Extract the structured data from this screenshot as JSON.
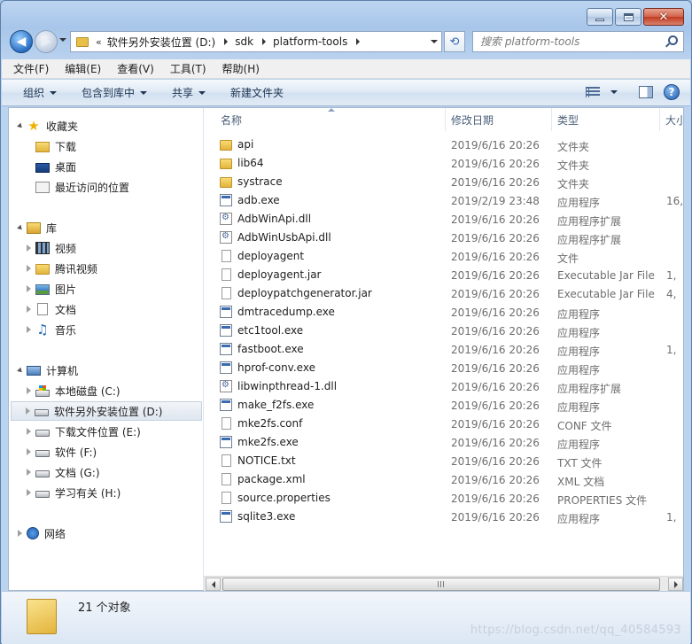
{
  "window": {
    "close_glyph": "✕"
  },
  "nav": {
    "address_chevron": "«",
    "breadcrumbs": [
      "软件另外安装位置 (D:)",
      "sdk",
      "platform-tools"
    ],
    "refresh_glyph": "⟲"
  },
  "search": {
    "placeholder": "搜索 platform-tools"
  },
  "menubar": [
    "文件(F)",
    "编辑(E)",
    "查看(V)",
    "工具(T)",
    "帮助(H)"
  ],
  "toolbar": {
    "organize": "组织",
    "include_library": "包含到库中",
    "share": "共享",
    "new_folder": "新建文件夹",
    "help_glyph": "?"
  },
  "sidebar": {
    "favorites": {
      "label": "收藏夹",
      "items": [
        "下载",
        "桌面",
        "最近访问的位置"
      ]
    },
    "libraries": {
      "label": "库",
      "items": [
        "视频",
        "腾讯视频",
        "图片",
        "文档",
        "音乐"
      ]
    },
    "computer": {
      "label": "计算机",
      "items": [
        "本地磁盘 (C:)",
        "软件另外安装位置 (D:)",
        "下载文件位置 (E:)",
        "软件 (F:)",
        "文档 (G:)",
        "学习有关 (H:)"
      ],
      "selected_index": 1
    },
    "network": {
      "label": "网络"
    }
  },
  "columns": {
    "name": "名称",
    "date": "修改日期",
    "type": "类型",
    "size": "大小"
  },
  "files": [
    {
      "name": "api",
      "date": "2019/6/16 20:26",
      "type": "文件夹",
      "size": "",
      "icon": "folder"
    },
    {
      "name": "lib64",
      "date": "2019/6/16 20:26",
      "type": "文件夹",
      "size": "",
      "icon": "folder"
    },
    {
      "name": "systrace",
      "date": "2019/6/16 20:26",
      "type": "文件夹",
      "size": "",
      "icon": "folder"
    },
    {
      "name": "adb.exe",
      "date": "2019/2/19 23:48",
      "type": "应用程序",
      "size": "16,",
      "icon": "exe"
    },
    {
      "name": "AdbWinApi.dll",
      "date": "2019/6/16 20:26",
      "type": "应用程序扩展",
      "size": "",
      "icon": "dll"
    },
    {
      "name": "AdbWinUsbApi.dll",
      "date": "2019/6/16 20:26",
      "type": "应用程序扩展",
      "size": "",
      "icon": "dll"
    },
    {
      "name": "deployagent",
      "date": "2019/6/16 20:26",
      "type": "文件",
      "size": "",
      "icon": "file"
    },
    {
      "name": "deployagent.jar",
      "date": "2019/6/16 20:26",
      "type": "Executable Jar File",
      "size": "1,",
      "icon": "file"
    },
    {
      "name": "deploypatchgenerator.jar",
      "date": "2019/6/16 20:26",
      "type": "Executable Jar File",
      "size": "4,",
      "icon": "file"
    },
    {
      "name": "dmtracedump.exe",
      "date": "2019/6/16 20:26",
      "type": "应用程序",
      "size": "",
      "icon": "exe"
    },
    {
      "name": "etc1tool.exe",
      "date": "2019/6/16 20:26",
      "type": "应用程序",
      "size": "",
      "icon": "exe"
    },
    {
      "name": "fastboot.exe",
      "date": "2019/6/16 20:26",
      "type": "应用程序",
      "size": "1,",
      "icon": "exe"
    },
    {
      "name": "hprof-conv.exe",
      "date": "2019/6/16 20:26",
      "type": "应用程序",
      "size": "",
      "icon": "exe"
    },
    {
      "name": "libwinpthread-1.dll",
      "date": "2019/6/16 20:26",
      "type": "应用程序扩展",
      "size": "",
      "icon": "dll"
    },
    {
      "name": "make_f2fs.exe",
      "date": "2019/6/16 20:26",
      "type": "应用程序",
      "size": "",
      "icon": "exe"
    },
    {
      "name": "mke2fs.conf",
      "date": "2019/6/16 20:26",
      "type": "CONF 文件",
      "size": "",
      "icon": "file"
    },
    {
      "name": "mke2fs.exe",
      "date": "2019/6/16 20:26",
      "type": "应用程序",
      "size": "",
      "icon": "exe"
    },
    {
      "name": "NOTICE.txt",
      "date": "2019/6/16 20:26",
      "type": "TXT 文件",
      "size": "",
      "icon": "file"
    },
    {
      "name": "package.xml",
      "date": "2019/6/16 20:26",
      "type": "XML 文档",
      "size": "",
      "icon": "file"
    },
    {
      "name": "source.properties",
      "date": "2019/6/16 20:26",
      "type": "PROPERTIES 文件",
      "size": "",
      "icon": "file"
    },
    {
      "name": "sqlite3.exe",
      "date": "2019/6/16 20:26",
      "type": "应用程序",
      "size": "1,",
      "icon": "exe"
    }
  ],
  "status": {
    "count": "21 个对象"
  },
  "watermark": "https://blog.csdn.net/qq_40584593"
}
